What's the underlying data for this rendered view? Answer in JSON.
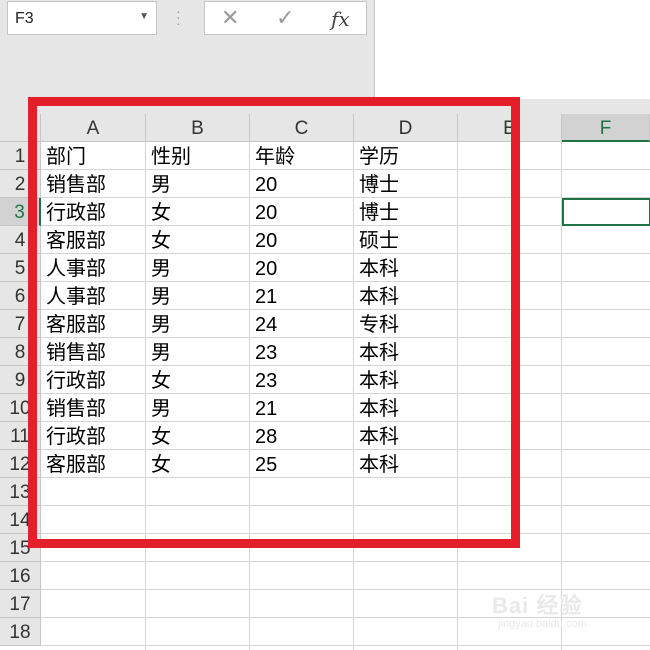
{
  "name_box": {
    "value": "F3"
  },
  "formula_bar": {
    "cancel_glyph": "✕",
    "enter_glyph": "✓",
    "fx_label": "fx"
  },
  "columns": [
    "A",
    "B",
    "C",
    "D",
    "E",
    "F"
  ],
  "selected_column": "F",
  "rows": [
    "1",
    "2",
    "3",
    "4",
    "5",
    "6",
    "7",
    "8",
    "9",
    "10",
    "11",
    "12",
    "13",
    "14",
    "15",
    "16",
    "17",
    "18"
  ],
  "selected_row": "3",
  "active_cell": "F3",
  "table": {
    "headers": [
      "部门",
      "性别",
      "年龄",
      "学历"
    ],
    "rows": [
      [
        "销售部",
        "男",
        "20",
        "博士"
      ],
      [
        "行政部",
        "女",
        "20",
        "博士"
      ],
      [
        "客服部",
        "女",
        "20",
        "硕士"
      ],
      [
        "人事部",
        "男",
        "20",
        "本科"
      ],
      [
        "人事部",
        "男",
        "21",
        "本科"
      ],
      [
        "客服部",
        "男",
        "24",
        "专科"
      ],
      [
        "销售部",
        "男",
        "23",
        "本科"
      ],
      [
        "行政部",
        "女",
        "23",
        "本科"
      ],
      [
        "销售部",
        "男",
        "21",
        "本科"
      ],
      [
        "行政部",
        "女",
        "28",
        "本科"
      ],
      [
        "客服部",
        "女",
        "25",
        "本科"
      ]
    ]
  },
  "highlight_color": "#e51f29",
  "accent_color": "#217346",
  "watermark": {
    "brand": "Bai 经验",
    "url": "jingyan.baidu.com"
  }
}
